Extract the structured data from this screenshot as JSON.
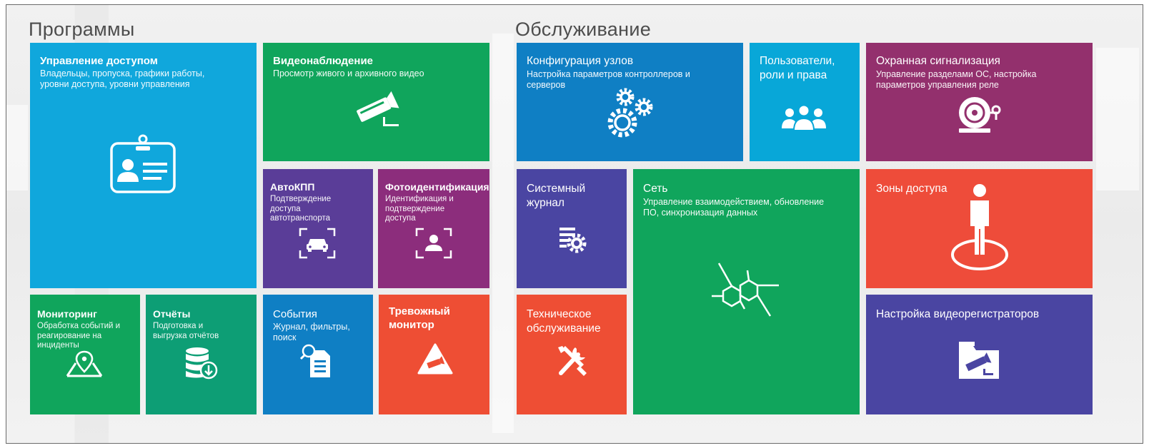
{
  "sections": {
    "programs": "Программы",
    "maintenance": "Обслуживание"
  },
  "tiles": {
    "access_control": {
      "title": "Управление доступом",
      "desc": "Владельцы, пропуска, графики работы, уровни доступа, уровни управления"
    },
    "video": {
      "title": "Видеонаблюдение",
      "desc": "Просмотр живого и архивного видео"
    },
    "autokpp": {
      "title": "АвтоКПП",
      "desc": "Подтверждение доступа автотранспорта"
    },
    "photo_id": {
      "title": "Фотоидентификация",
      "desc": "Идентификация и подтверждение доступа"
    },
    "monitoring": {
      "title": "Мониторинг",
      "desc": "Обработка событий и реагирование на инциденты"
    },
    "reports": {
      "title": "Отчёты",
      "desc": "Подготовка и выгрузка отчётов"
    },
    "events": {
      "title": "События",
      "desc": "Журнал, фильтры, поиск"
    },
    "alarm_monitor": {
      "title": "Тревожный монитор"
    },
    "node_config": {
      "title": "Конфигурация узлов",
      "desc": "Настройка параметров контроллеров и серверов"
    },
    "users": {
      "title": "Пользователи, роли и права"
    },
    "security_alarm": {
      "title": "Охранная сигнализация",
      "desc": "Управление разделами ОС, настройка параметров управления реле"
    },
    "system_log": {
      "title": "Системный журнал"
    },
    "network": {
      "title": "Сеть",
      "desc": "Управление взаимодействием, обновление ПО, синхронизация данных"
    },
    "access_zones": {
      "title": "Зоны доступа"
    },
    "maintenance": {
      "title": "Техническое обслуживание"
    },
    "dvr_setup": {
      "title": "Настройка видеорегистраторов"
    }
  },
  "colors": {
    "cyan": "#10a7dc",
    "green": "#10a55c",
    "teal": "#0d9e75",
    "blue": "#0f7fc4",
    "purple": "#5a3d98",
    "indigo": "#4a45a2",
    "magenta": "#8c2d7c",
    "plum": "#93306d",
    "red": "#ee4e34"
  },
  "icons": {
    "access_control": "id-card-icon",
    "video": "cctv-camera-icon",
    "autokpp": "car-scan-icon",
    "photo_id": "face-scan-icon",
    "monitoring": "map-pin-icon",
    "reports": "database-download-icon",
    "events": "document-search-icon",
    "alarm_monitor": "camera-warning-icon",
    "node_config": "gears-icon",
    "users": "users-group-icon",
    "security_alarm": "alarm-bell-icon",
    "system_log": "log-settings-icon",
    "network": "network-molecule-icon",
    "access_zones": "person-zone-icon",
    "maintenance": "tools-icon",
    "dvr_setup": "dvr-folder-icon"
  }
}
